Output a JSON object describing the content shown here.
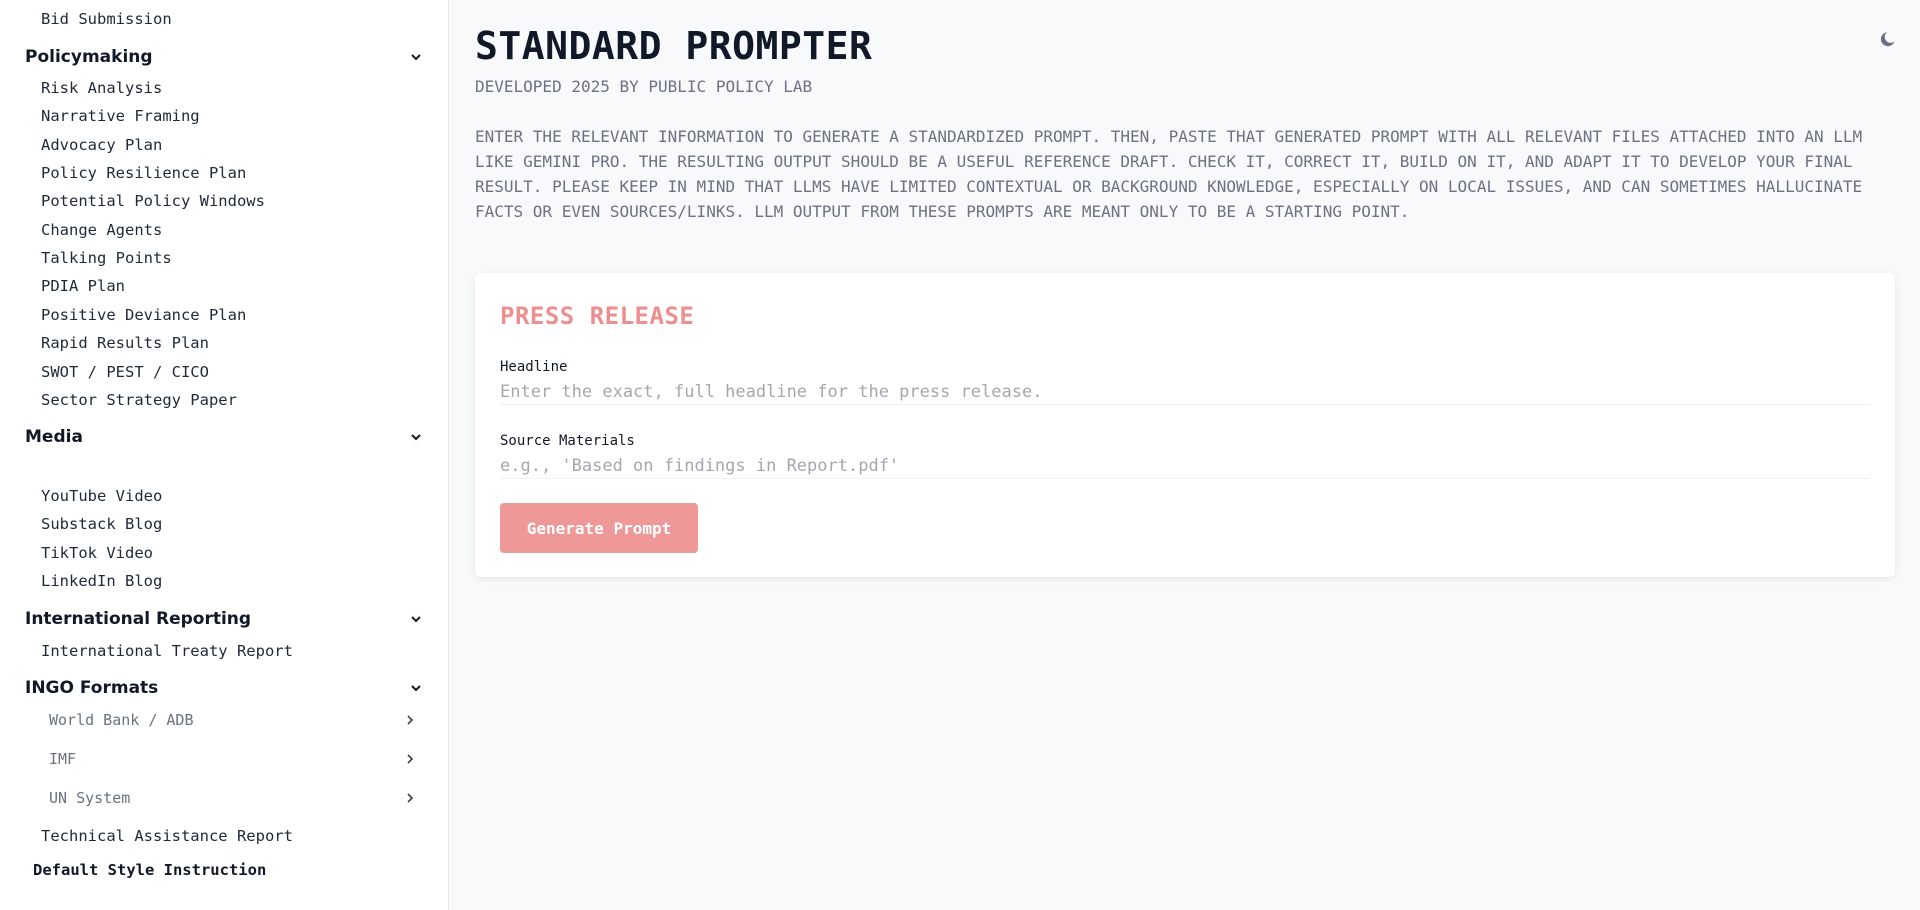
{
  "sidebar": {
    "top_items": [
      {
        "label": "Bid Submission"
      }
    ],
    "policymaking": {
      "title": "Policymaking",
      "items": [
        {
          "label": "Risk Analysis"
        },
        {
          "label": "Narrative Framing"
        },
        {
          "label": "Advocacy Plan"
        },
        {
          "label": "Policy Resilience Plan"
        },
        {
          "label": "Potential Policy Windows"
        },
        {
          "label": "Change Agents"
        },
        {
          "label": "Talking Points"
        },
        {
          "label": "PDIA Plan"
        },
        {
          "label": "Positive Deviance Plan"
        },
        {
          "label": "Rapid Results Plan"
        },
        {
          "label": "SWOT / PEST / CICO"
        },
        {
          "label": "Sector Strategy Paper"
        }
      ]
    },
    "media": {
      "title": "Media",
      "items": [
        {
          "label": "YouTube Video"
        },
        {
          "label": "Substack Blog"
        },
        {
          "label": "TikTok Video"
        },
        {
          "label": "LinkedIn Blog"
        }
      ]
    },
    "international_reporting": {
      "title": "International Reporting",
      "items": [
        {
          "label": "International Treaty Report"
        }
      ]
    },
    "ingo_formats": {
      "title": "INGO Formats",
      "subgroups": [
        {
          "label": "World Bank / ADB"
        },
        {
          "label": "IMF"
        },
        {
          "label": "UN System"
        }
      ],
      "items": [
        {
          "label": "Technical Assistance Report"
        }
      ]
    },
    "default_style": "Default Style Instruction"
  },
  "header": {
    "title": "STANDARD PROMPTER",
    "subtitle": "DEVELOPED 2025 BY PUBLIC POLICY LAB",
    "description": "ENTER THE RELEVANT INFORMATION TO GENERATE A STANDARDIZED PROMPT. THEN, PASTE THAT GENERATED PROMPT WITH ALL RELEVANT FILES ATTACHED INTO AN LLM LIKE GEMINI PRO. THE RESULTING OUTPUT SHOULD BE A USEFUL REFERENCE DRAFT. CHECK IT, CORRECT IT, BUILD ON IT, AND ADAPT IT TO DEVELOP YOUR FINAL RESULT. PLEASE KEEP IN MIND THAT LLMS HAVE LIMITED CONTEXTUAL OR BACKGROUND KNOWLEDGE, ESPECIALLY ON LOCAL ISSUES, AND CAN SOMETIMES HALLUCINATE FACTS OR EVEN SOURCES/LINKS. LLM OUTPUT FROM THESE PROMPTS ARE MEANT ONLY TO BE A STARTING POINT.",
    "theme_icon": "moon-icon"
  },
  "form": {
    "title": "PRESS RELEASE",
    "headline": {
      "label": "Headline",
      "value": "",
      "placeholder": "Enter the exact, full headline for the press release."
    },
    "source_materials": {
      "label": "Source Materials",
      "value": "",
      "placeholder": "e.g., 'Based on findings in Report.pdf'"
    },
    "button_label": "Generate Prompt"
  },
  "colors": {
    "accent": "#ee9898",
    "accent_text": "#ee8f8f",
    "background": "#f8f9fb",
    "sidebar_bg": "#ffffff"
  }
}
